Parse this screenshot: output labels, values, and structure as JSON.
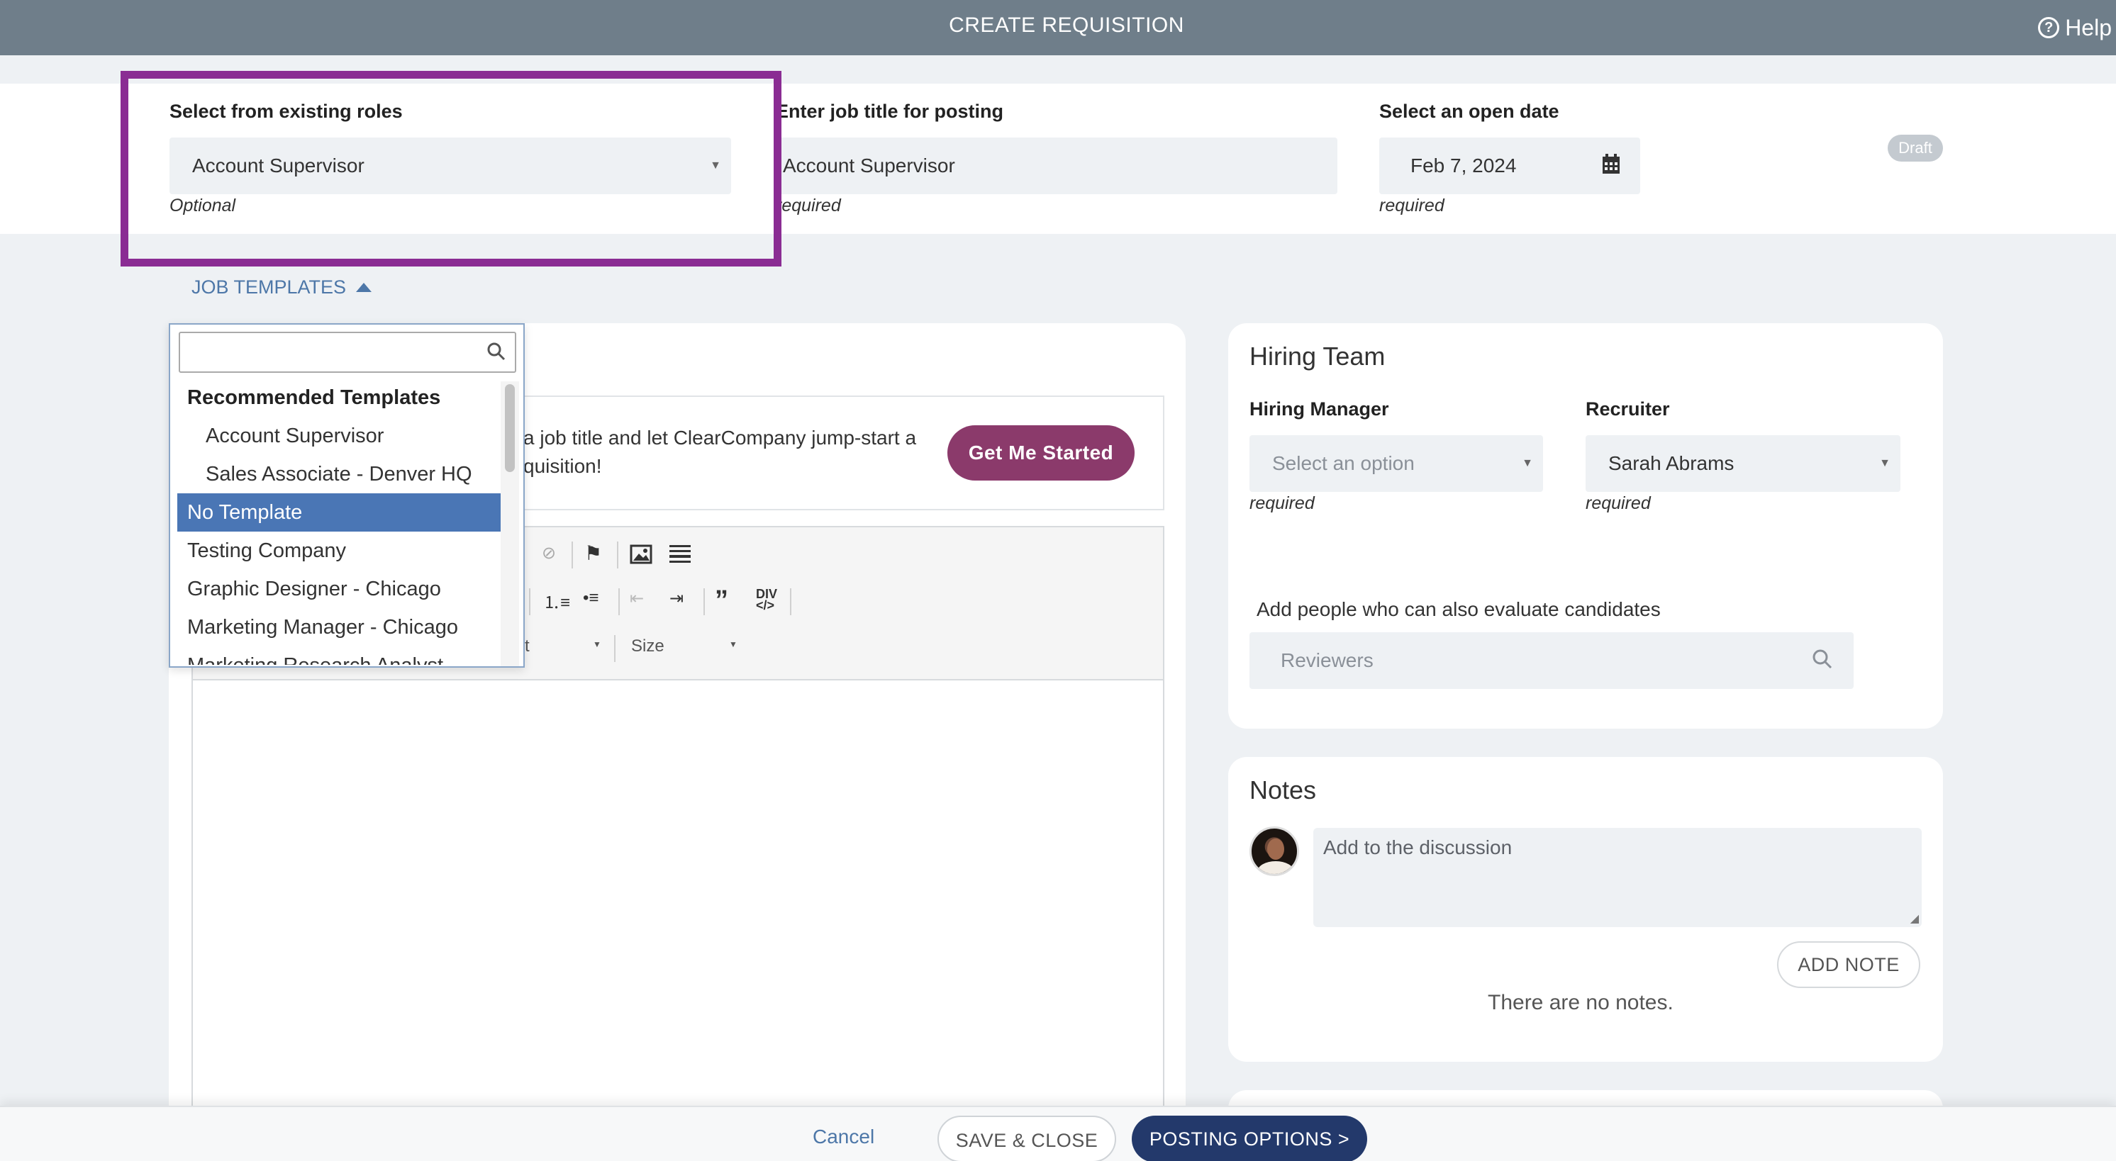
{
  "header": {
    "title": "CREATE REQUISITION",
    "help_label": "Help",
    "help_icon": "question-circle-icon"
  },
  "form": {
    "existing_roles": {
      "label": "Select from existing roles",
      "value": "Account Supervisor",
      "hint": "Optional"
    },
    "job_title": {
      "label": "Enter job title for posting",
      "value": "Account Supervisor",
      "hint": "required"
    },
    "open_date": {
      "label": "Select an open date",
      "value": "Feb 7, 2024",
      "hint": "required"
    },
    "status_badge": "Draft"
  },
  "job_templates": {
    "toggle_label": "JOB TEMPLATES",
    "dropdown": {
      "group_label": "Recommended Templates",
      "recommended": [
        "Account Supervisor",
        "Sales Associate - Denver HQ"
      ],
      "items": [
        "No Template",
        "Testing Company",
        "Graphic Designer - Chicago",
        "Marketing Manager - Chicago",
        "Marketing Research Analyst"
      ],
      "selected": "No Template"
    }
  },
  "editor": {
    "hero_text_line1": "a job title and let ClearCompany jump-start a",
    "hero_text_line2": "quisition!",
    "get_started_label": "Get Me Started",
    "font_select_partial": "t",
    "size_select_label": "Size"
  },
  "hiring_team": {
    "title": "Hiring Team",
    "hiring_manager": {
      "label": "Hiring Manager",
      "placeholder": "Select an option",
      "hint": "required"
    },
    "recruiter": {
      "label": "Recruiter",
      "value": "Sarah Abrams",
      "hint": "required"
    },
    "reviewers": {
      "label": "Add people who can also evaluate candidates",
      "placeholder": "Reviewers"
    }
  },
  "notes": {
    "title": "Notes",
    "placeholder": "Add to the discussion",
    "add_note_label": "ADD NOTE",
    "empty_text": "There are no notes."
  },
  "footer": {
    "cancel_label": "Cancel",
    "save_close_label": "SAVE & CLOSE",
    "posting_options_label": "POSTING OPTIONS >"
  },
  "colors": {
    "header_bg": "#6f7e8a",
    "highlight_border": "#8a2c93",
    "primary_button": "#23396b",
    "get_started_button": "#8b3a6b",
    "selected_item": "#4a76b5"
  }
}
